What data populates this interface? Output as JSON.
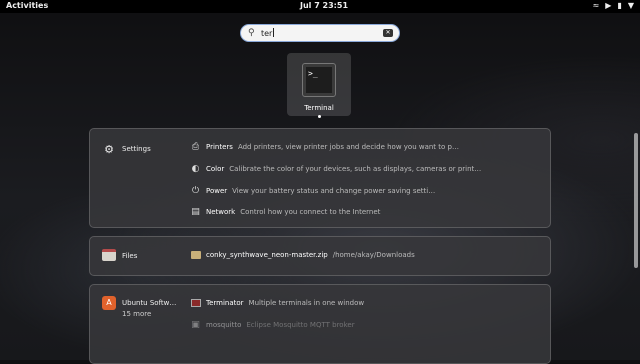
{
  "topbar": {
    "activities": "Activities",
    "clock": "Jul 7  23:51",
    "tray_icons": [
      "wifi-icon",
      "volume-icon",
      "battery-icon",
      "power-menu-icon"
    ]
  },
  "search": {
    "query": "ter",
    "icon": "search-icon"
  },
  "app_result": {
    "label": "Terminal",
    "icon": "terminal-icon",
    "icon_text": ">_"
  },
  "settings_panel": {
    "provider": "Settings",
    "results": [
      {
        "title": "Printers",
        "desc": "Add printers, view printer jobs and decide how you want to p…",
        "icon": "printer-icon"
      },
      {
        "title": "Color",
        "desc": "Calibrate the color of your devices, such as displays, cameras or print…",
        "icon": "color-icon"
      },
      {
        "title": "Power",
        "desc": "View your battery status and change power saving setti…",
        "icon": "power-icon"
      },
      {
        "title": "Network",
        "desc": "Control how you connect to the Internet",
        "icon": "network-icon"
      }
    ]
  },
  "files_panel": {
    "provider": "Files",
    "results": [
      {
        "title": "conky_synthwave_neon-master.zip",
        "desc": "/home/akay/Downloads",
        "icon": "folder-icon"
      }
    ]
  },
  "software_panel": {
    "provider": "Ubuntu Softw…",
    "more": "15 more",
    "results": [
      {
        "title": "Terminator",
        "desc": "Multiple terminals in one window",
        "icon": "terminator-icon"
      },
      {
        "title": "mosquitto",
        "desc": "Eclipse Mosquitto MQTT broker",
        "icon": "package-icon"
      }
    ]
  }
}
